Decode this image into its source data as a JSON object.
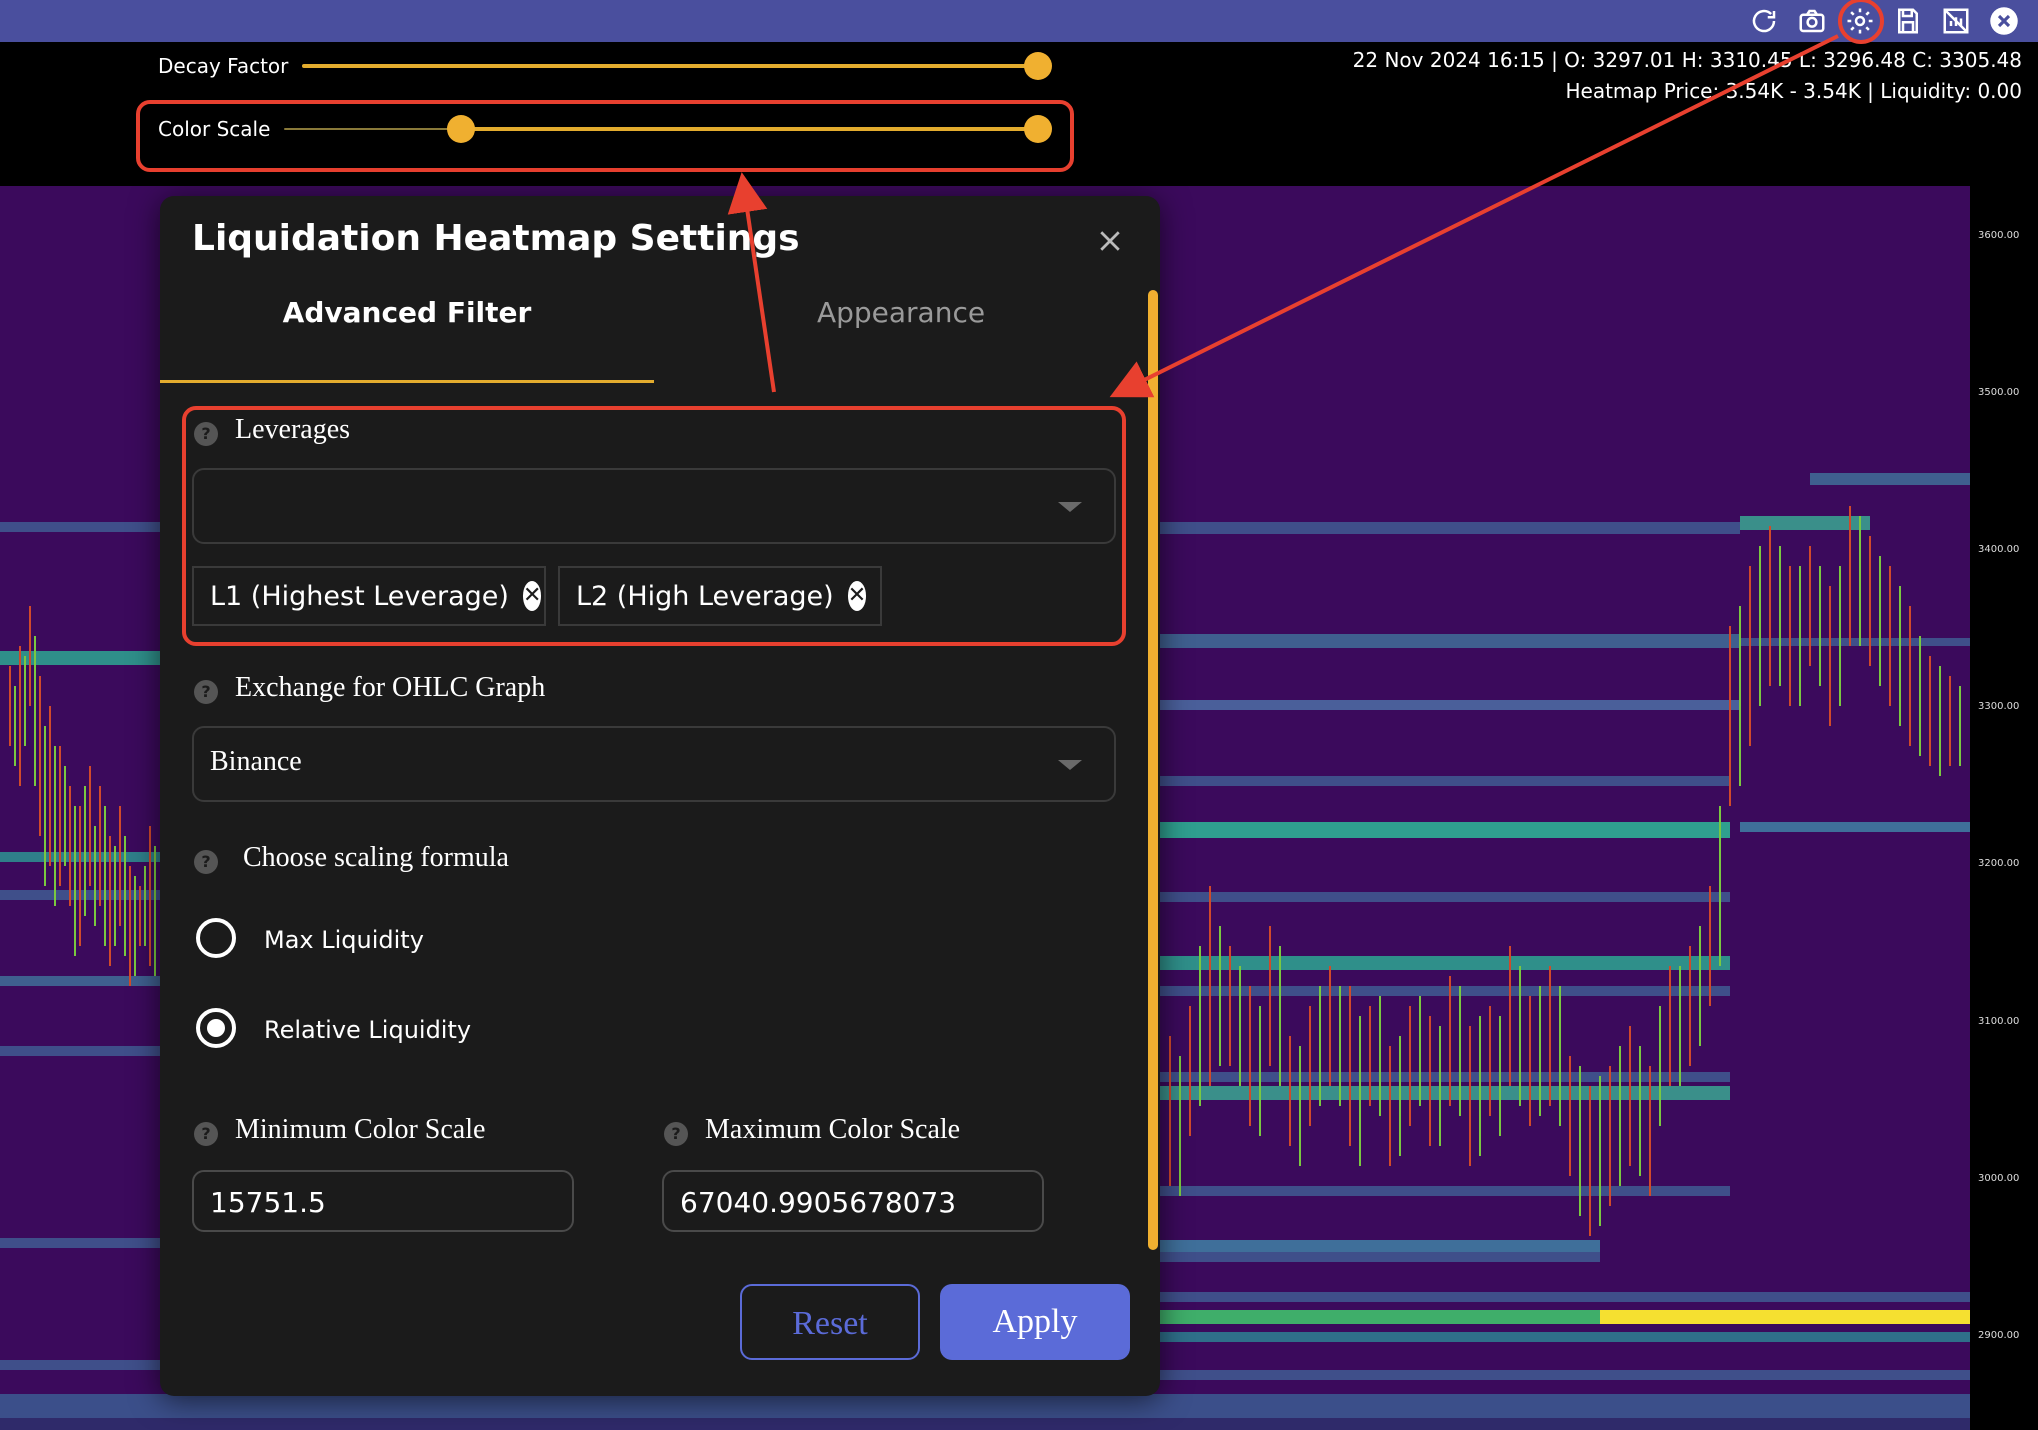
{
  "slider_bar": {
    "decay_factor_label": "Decay Factor",
    "color_scale_label": "Color Scale"
  },
  "info": {
    "ohlc_line": "22 Nov 2024 16:15 | O: 3297.01 H: 3310.45 L: 3296.48 C: 3305.48",
    "heatmap_line": "Heatmap Price: 3.54K - 3.54K | Liquidity: 0.00"
  },
  "toolbar": {
    "icons": [
      "refresh-icon",
      "camera-icon",
      "gear-icon",
      "save-icon",
      "chart-toggle-icon",
      "close-icon"
    ]
  },
  "yaxis": {
    "ticks": [
      "3600.00",
      "3500.00",
      "3400.00",
      "3300.00",
      "3200.00",
      "3100.00",
      "3000.00",
      "2900.00"
    ]
  },
  "dialog": {
    "title": "Liquidation Heatmap Settings",
    "tabs": [
      "Advanced Filter",
      "Appearance"
    ],
    "leverages": {
      "label": "Leverages",
      "chips": [
        "L1 (Highest Leverage)",
        "L2 (High Leverage)"
      ]
    },
    "exchange": {
      "label": "Exchange for OHLC Graph",
      "value": "Binance"
    },
    "scaling": {
      "label": "Choose scaling formula",
      "options": [
        "Max Liquidity",
        "Relative Liquidity"
      ],
      "selected": "Relative Liquidity"
    },
    "min_color": {
      "label": "Minimum Color Scale",
      "value": "15751.5"
    },
    "max_color": {
      "label": "Maximum Color Scale",
      "value": "67040.9905678073"
    },
    "buttons": {
      "reset": "Reset",
      "apply": "Apply"
    }
  },
  "colors": {
    "toolbar": "#4a4f9e",
    "heatmap_bg": "#3b0a5c",
    "accent": "#e3ac2e",
    "button": "#5b6bd8",
    "annotation": "#e8402f"
  }
}
